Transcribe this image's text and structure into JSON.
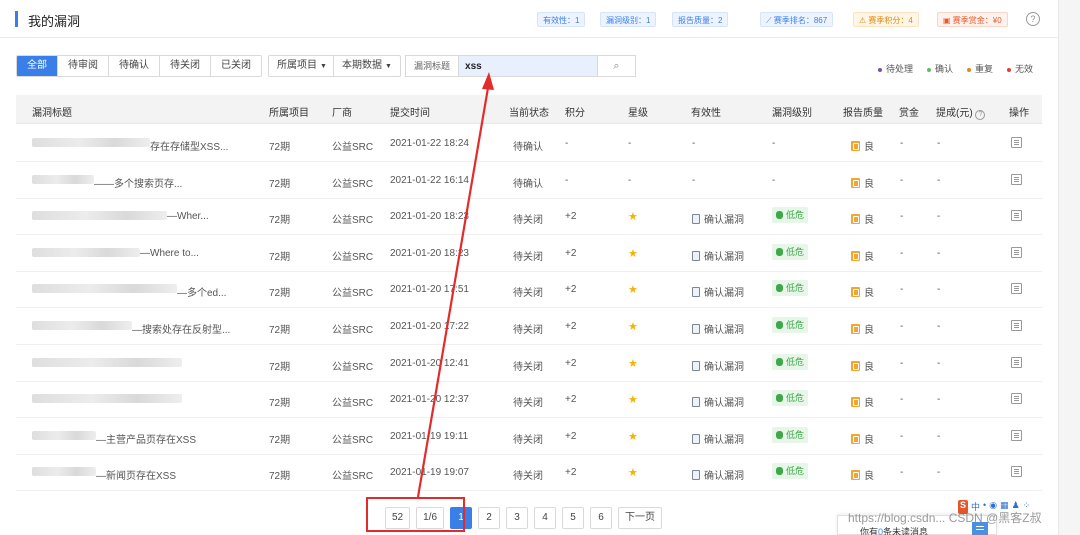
{
  "header": {
    "title": "我的漏洞",
    "tags": [
      "有效性：1",
      "漏洞级别：1",
      "报告质量：2"
    ],
    "season_rank": "赛季排名：867",
    "season_points": "赛季积分：4",
    "season_bounty": "赛季赏金：¥0",
    "help_icon": "?"
  },
  "filters": {
    "status_tabs": [
      "全部",
      "待审阅",
      "待确认",
      "待关闭",
      "已关闭"
    ],
    "active_status": "全部",
    "project_dropdown": "所属项目",
    "period_dropdown": "本期数据",
    "search_label": "漏洞标题",
    "search_value": "xss",
    "search_icon": "⌕"
  },
  "legend": [
    {
      "label": "待处理",
      "color": "#7a4fb0"
    },
    {
      "label": "确认",
      "color": "#5cbf64"
    },
    {
      "label": "重复",
      "color": "#e08a12"
    },
    {
      "label": "无效",
      "color": "#e33b3b"
    }
  ],
  "table": {
    "columns": [
      "漏洞标题",
      "所属项目",
      "厂商",
      "提交时间",
      "当前状态",
      "积分",
      "星级",
      "有效性",
      "漏洞级别",
      "报告质量",
      "赏金",
      "提成(元)",
      "操作"
    ],
    "rows": [
      {
        "title": "存在存储型XSS...",
        "project": "72期",
        "vendor": "公益SRC",
        "time": "2021-01-22 18:24",
        "status": "待确认",
        "points": "-",
        "star": "-",
        "validity": "-",
        "level": "-",
        "quality": "良",
        "bounty": "-",
        "commission": "-"
      },
      {
        "title": "——多个搜索页存...",
        "project": "72期",
        "vendor": "公益SRC",
        "time": "2021-01-22 16:14",
        "status": "待确认",
        "points": "-",
        "star": "-",
        "validity": "-",
        "level": "-",
        "quality": "良",
        "bounty": "-",
        "commission": "-"
      },
      {
        "title": "—Wher...",
        "project": "72期",
        "vendor": "公益SRC",
        "time": "2021-01-20 18:23",
        "status": "待关闭",
        "points": "+2",
        "star": "★",
        "validity": "确认漏洞",
        "level": "低危",
        "quality": "良",
        "bounty": "-",
        "commission": "-"
      },
      {
        "title": "—Where to...",
        "project": "72期",
        "vendor": "公益SRC",
        "time": "2021-01-20 18:23",
        "status": "待关闭",
        "points": "+2",
        "star": "★",
        "validity": "确认漏洞",
        "level": "低危",
        "quality": "良",
        "bounty": "-",
        "commission": "-"
      },
      {
        "title": "—多个ed...",
        "project": "72期",
        "vendor": "公益SRC",
        "time": "2021-01-20 17:51",
        "status": "待关闭",
        "points": "+2",
        "star": "★",
        "validity": "确认漏洞",
        "level": "低危",
        "quality": "良",
        "bounty": "-",
        "commission": "-"
      },
      {
        "title": "—搜索处存在反射型...",
        "project": "72期",
        "vendor": "公益SRC",
        "time": "2021-01-20 17:22",
        "status": "待关闭",
        "points": "+2",
        "star": "★",
        "validity": "确认漏洞",
        "level": "低危",
        "quality": "良",
        "bounty": "-",
        "commission": "-"
      },
      {
        "title": "",
        "project": "72期",
        "vendor": "公益SRC",
        "time": "2021-01-20 12:41",
        "status": "待关闭",
        "points": "+2",
        "star": "★",
        "validity": "确认漏洞",
        "level": "低危",
        "quality": "良",
        "bounty": "-",
        "commission": "-"
      },
      {
        "title": "",
        "project": "72期",
        "vendor": "公益SRC",
        "time": "2021-01-20 12:37",
        "status": "待关闭",
        "points": "+2",
        "star": "★",
        "validity": "确认漏洞",
        "level": "低危",
        "quality": "良",
        "bounty": "-",
        "commission": "-"
      },
      {
        "title": "—主营产品页存在XSS",
        "project": "72期",
        "vendor": "公益SRC",
        "time": "2021-01-19 19:11",
        "status": "待关闭",
        "points": "+2",
        "star": "★",
        "validity": "确认漏洞",
        "level": "低危",
        "quality": "良",
        "bounty": "-",
        "commission": "-"
      },
      {
        "title": "—新闻页存在XSS",
        "project": "72期",
        "vendor": "公益SRC",
        "time": "2021-01-19 19:07",
        "status": "待关闭",
        "points": "+2",
        "star": "★",
        "validity": "确认漏洞",
        "level": "低危",
        "quality": "良",
        "bounty": "-",
        "commission": "-"
      }
    ]
  },
  "pagination": {
    "total": "52",
    "page_of": "1/6",
    "pages": [
      "1",
      "2",
      "3",
      "4",
      "5",
      "6"
    ],
    "current": "1",
    "next_label": "下一页"
  },
  "notification": {
    "prefix": "你有",
    "count": "0",
    "suffix": "条未读消息"
  },
  "watermark": "https://blog.csdn... CSDN @黑客Z叔",
  "tray": {
    "logo": "S",
    "lang": "中"
  },
  "colors": {
    "accent": "#3a7ee8",
    "annotation_red": "#e32b2b",
    "low_level_green": "#3ea94a",
    "star_gold": "#f5b400"
  }
}
